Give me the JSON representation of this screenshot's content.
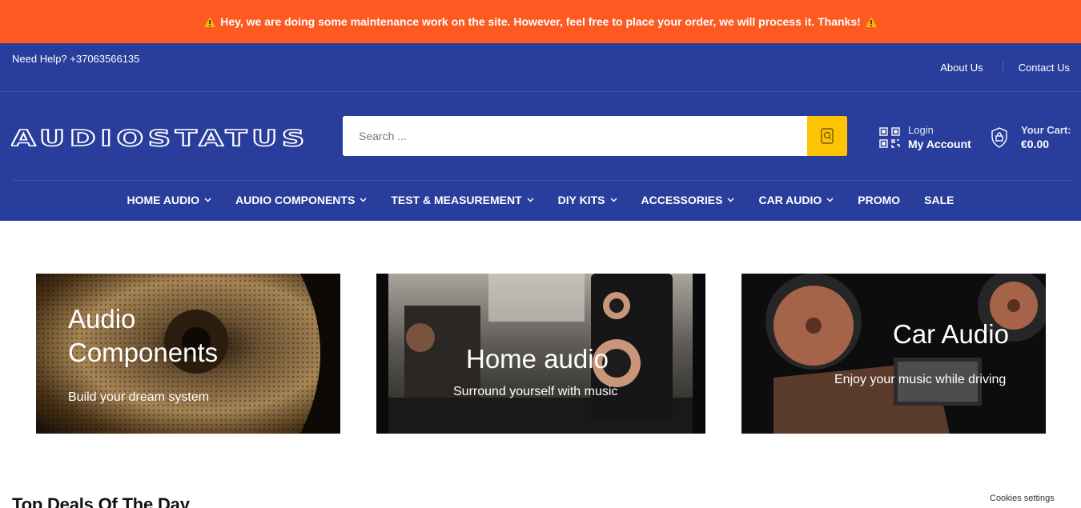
{
  "notice": {
    "text": "Hey, we are doing some maintenance work on the site. However, feel free to place your order, we will process it. Thanks!"
  },
  "topbar": {
    "help": "Need Help? +37063566135",
    "links": [
      "About Us",
      "Contact Us"
    ]
  },
  "header": {
    "logo_text": "AUDIOSTATUS",
    "search_placeholder": "Search ...",
    "account": {
      "line1": "Login",
      "line2": "My Account"
    },
    "cart": {
      "line1": "Your Cart:",
      "line2": "€0.00"
    }
  },
  "nav": [
    {
      "label": "Home Audio",
      "dropdown": true
    },
    {
      "label": "Audio Components",
      "dropdown": true
    },
    {
      "label": "Test & Measurement",
      "dropdown": true
    },
    {
      "label": "DIY Kits",
      "dropdown": true
    },
    {
      "label": "Accessories",
      "dropdown": true
    },
    {
      "label": "Car Audio",
      "dropdown": true
    },
    {
      "label": "Promo",
      "dropdown": false
    },
    {
      "label": "Sale",
      "dropdown": false
    }
  ],
  "cards": [
    {
      "title_line1": "Audio",
      "title_line2": "Components",
      "subtitle": "Build your dream system"
    },
    {
      "title": "Home audio",
      "subtitle": "Surround yourself with music"
    },
    {
      "title": "Car Audio",
      "subtitle": "Enjoy your music while driving"
    }
  ],
  "section_title": "Top Deals Of The Day",
  "cookies": "Cookies settings",
  "colors": {
    "notice": "#fd5a22",
    "brand": "#293e9c",
    "accent": "#fec303"
  }
}
